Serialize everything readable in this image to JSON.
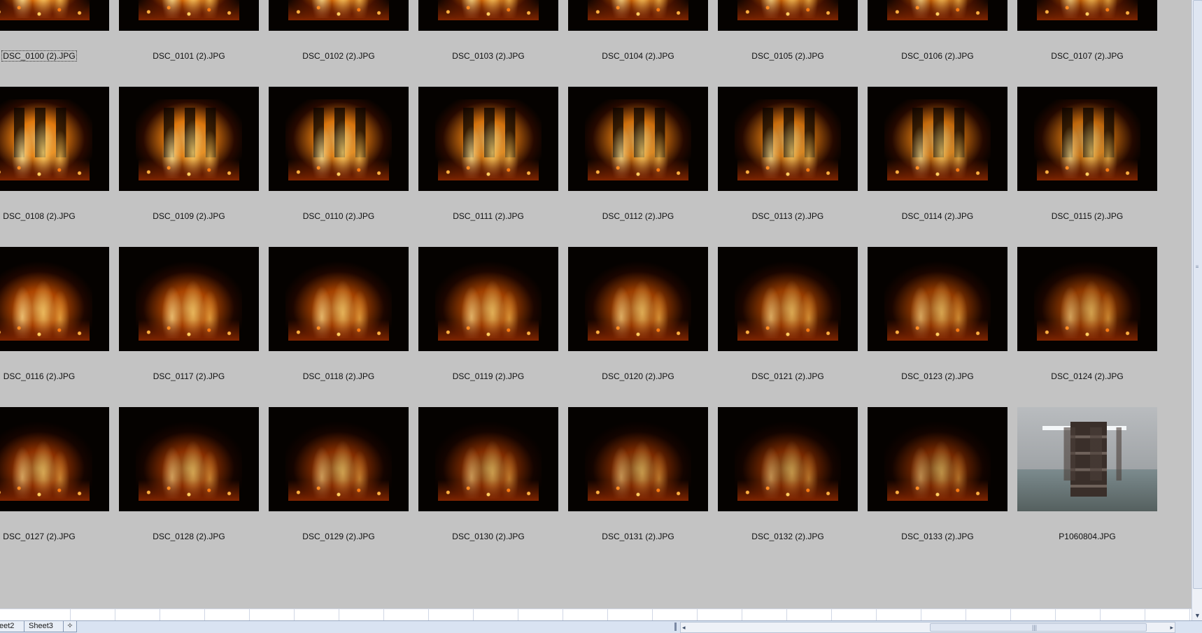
{
  "window": {
    "title": ""
  },
  "colors": {
    "background": "#c3c3c3",
    "fire": "#ff9a20",
    "tab_bar": "#d9e3f2"
  },
  "gallery": {
    "selected_index": 0,
    "items": [
      {
        "filename": "DSC_0100 (2).JPG",
        "kind": "fire"
      },
      {
        "filename": "DSC_0101 (2).JPG",
        "kind": "fire"
      },
      {
        "filename": "DSC_0102 (2).JPG",
        "kind": "fire"
      },
      {
        "filename": "DSC_0103 (2).JPG",
        "kind": "fire"
      },
      {
        "filename": "DSC_0104 (2).JPG",
        "kind": "fire"
      },
      {
        "filename": "DSC_0105 (2).JPG",
        "kind": "fire"
      },
      {
        "filename": "DSC_0106 (2).JPG",
        "kind": "fire"
      },
      {
        "filename": "DSC_0107 (2).JPG",
        "kind": "fire"
      },
      {
        "filename": "DSC_0108 (2).JPG",
        "kind": "fire"
      },
      {
        "filename": "DSC_0109 (2).JPG",
        "kind": "fire"
      },
      {
        "filename": "DSC_0110 (2).JPG",
        "kind": "fire"
      },
      {
        "filename": "DSC_0111 (2).JPG",
        "kind": "fire"
      },
      {
        "filename": "DSC_0112 (2).JPG",
        "kind": "fire"
      },
      {
        "filename": "DSC_0113 (2).JPG",
        "kind": "fire"
      },
      {
        "filename": "DSC_0114 (2).JPG",
        "kind": "fire"
      },
      {
        "filename": "DSC_0115 (2).JPG",
        "kind": "fire"
      },
      {
        "filename": "DSC_0116 (2).JPG",
        "kind": "fire"
      },
      {
        "filename": "DSC_0117 (2).JPG",
        "kind": "fire"
      },
      {
        "filename": "DSC_0118 (2).JPG",
        "kind": "fire"
      },
      {
        "filename": "DSC_0119 (2).JPG",
        "kind": "fire"
      },
      {
        "filename": "DSC_0120 (2).JPG",
        "kind": "fire"
      },
      {
        "filename": "DSC_0121 (2).JPG",
        "kind": "fire"
      },
      {
        "filename": "DSC_0123 (2).JPG",
        "kind": "fire"
      },
      {
        "filename": "DSC_0124 (2).JPG",
        "kind": "fire"
      },
      {
        "filename": "DSC_0127 (2).JPG",
        "kind": "fire"
      },
      {
        "filename": "DSC_0128 (2).JPG",
        "kind": "fire"
      },
      {
        "filename": "DSC_0129 (2).JPG",
        "kind": "fire"
      },
      {
        "filename": "DSC_0130 (2).JPG",
        "kind": "fire"
      },
      {
        "filename": "DSC_0131 (2).JPG",
        "kind": "fire"
      },
      {
        "filename": "DSC_0132 (2).JPG",
        "kind": "fire"
      },
      {
        "filename": "DSC_0133 (2).JPG",
        "kind": "fire"
      },
      {
        "filename": "P1060804.JPG",
        "kind": "photo"
      }
    ]
  },
  "sheet_tabs": [
    {
      "label": "eet2"
    },
    {
      "label": "Sheet3"
    }
  ],
  "icons": {
    "insert_sheet": "insert-sheet-icon",
    "scroll_down": "scroll-down-icon",
    "scroll_left": "scroll-left-icon",
    "scroll_right": "scroll-right-icon"
  }
}
